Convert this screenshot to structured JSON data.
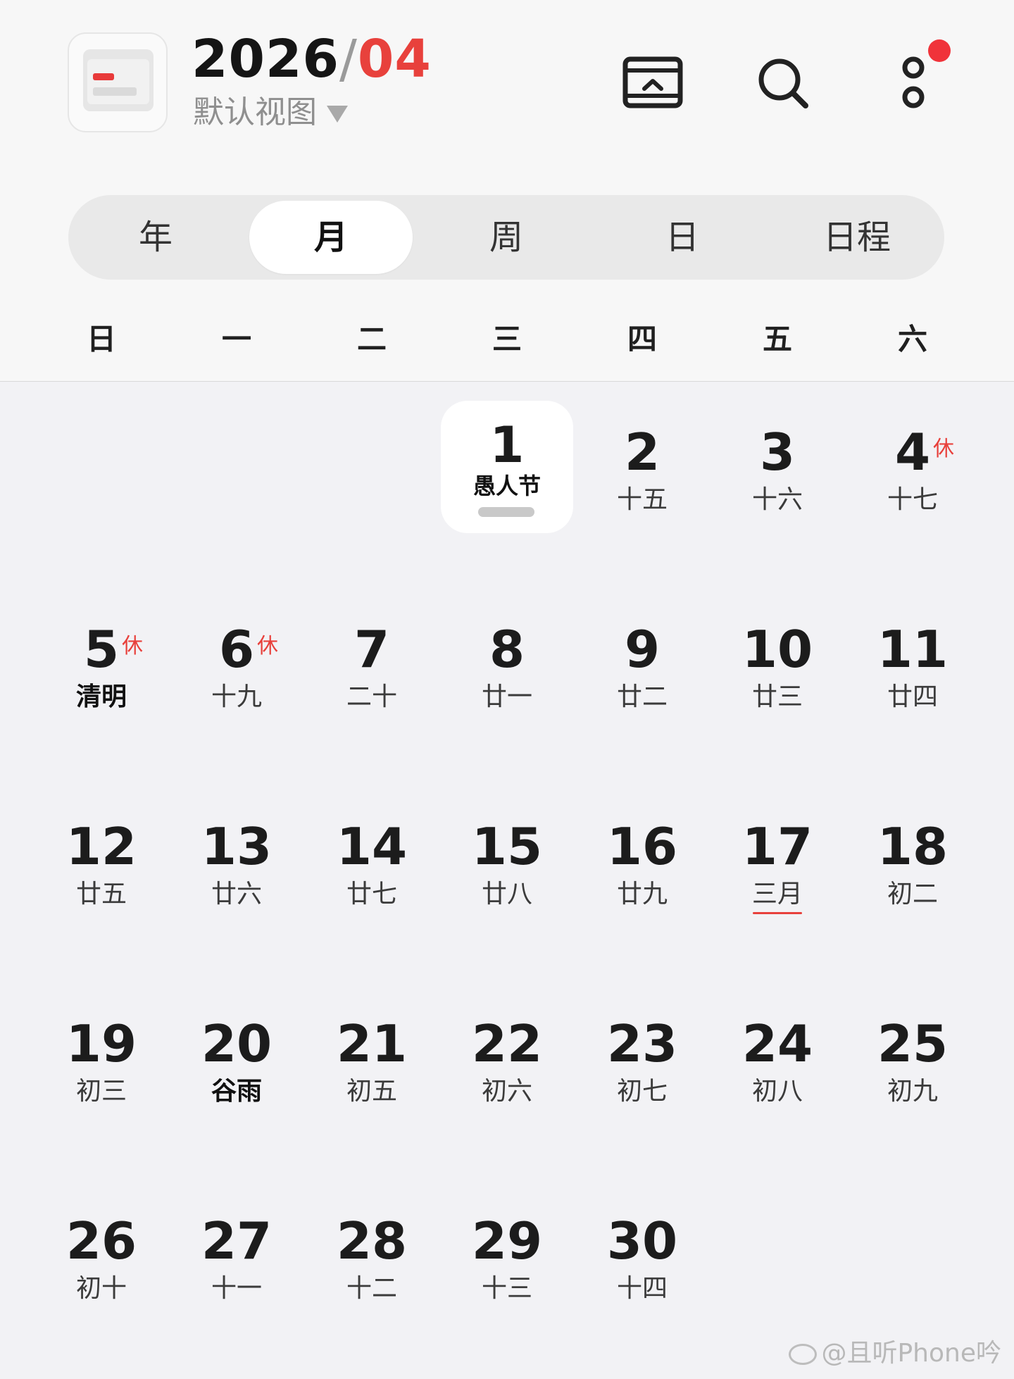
{
  "header": {
    "year": "2026",
    "separator": "/",
    "month": "04",
    "view_label": "默认视图"
  },
  "toolbar": {
    "today_icon": "calendar-return-icon",
    "search_icon": "search-icon",
    "menu_icon": "more-vertical-icon",
    "notification_dot": true
  },
  "tabs": [
    {
      "label": "年",
      "active": false
    },
    {
      "label": "月",
      "active": true
    },
    {
      "label": "周",
      "active": false
    },
    {
      "label": "日",
      "active": false
    },
    {
      "label": "日程",
      "active": false
    }
  ],
  "weekdays": [
    "日",
    "一",
    "二",
    "三",
    "四",
    "五",
    "六"
  ],
  "days": [
    {
      "num": "1",
      "lunar": "愚人节",
      "bold": true,
      "today": true,
      "event": true
    },
    {
      "num": "2",
      "lunar": "十五"
    },
    {
      "num": "3",
      "lunar": "十六"
    },
    {
      "num": "4",
      "lunar": "十七",
      "rest": "休"
    },
    {
      "num": "5",
      "lunar": "清明",
      "bold": true,
      "rest": "休"
    },
    {
      "num": "6",
      "lunar": "十九",
      "rest": "休"
    },
    {
      "num": "7",
      "lunar": "二十"
    },
    {
      "num": "8",
      "lunar": "廿一"
    },
    {
      "num": "9",
      "lunar": "廿二"
    },
    {
      "num": "10",
      "lunar": "廿三"
    },
    {
      "num": "11",
      "lunar": "廿四"
    },
    {
      "num": "12",
      "lunar": "廿五"
    },
    {
      "num": "13",
      "lunar": "廿六"
    },
    {
      "num": "14",
      "lunar": "廿七"
    },
    {
      "num": "15",
      "lunar": "廿八"
    },
    {
      "num": "16",
      "lunar": "廿九"
    },
    {
      "num": "17",
      "lunar": "三月",
      "underline": true
    },
    {
      "num": "18",
      "lunar": "初二"
    },
    {
      "num": "19",
      "lunar": "初三"
    },
    {
      "num": "20",
      "lunar": "谷雨",
      "bold": true
    },
    {
      "num": "21",
      "lunar": "初五"
    },
    {
      "num": "22",
      "lunar": "初六"
    },
    {
      "num": "23",
      "lunar": "初七"
    },
    {
      "num": "24",
      "lunar": "初八"
    },
    {
      "num": "25",
      "lunar": "初九"
    },
    {
      "num": "26",
      "lunar": "初十"
    },
    {
      "num": "27",
      "lunar": "十一"
    },
    {
      "num": "28",
      "lunar": "十二"
    },
    {
      "num": "29",
      "lunar": "十三"
    },
    {
      "num": "30",
      "lunar": "十四"
    }
  ],
  "first_weekday_index": 3,
  "watermark": "@且听Phone吟",
  "colors": {
    "accent": "#e8413c",
    "badge": "#f0333a"
  }
}
